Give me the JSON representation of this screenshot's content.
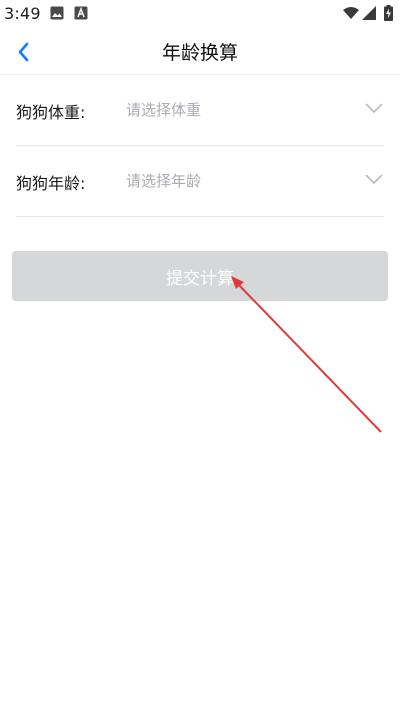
{
  "status_bar": {
    "time": "3:49",
    "icons": [
      "image-icon",
      "a-letter-icon",
      "wifi-icon",
      "signal-icon",
      "battery-charging-icon"
    ]
  },
  "nav": {
    "back_icon": "chevron-left-icon",
    "title": "年龄换算"
  },
  "form": {
    "weight": {
      "label": "狗狗体重:",
      "placeholder": "请选择体重",
      "icon": "chevron-down-icon"
    },
    "age": {
      "label": "狗狗年龄:",
      "placeholder": "请选择年龄",
      "icon": "chevron-down-icon"
    }
  },
  "submit": {
    "label": "提交计算"
  },
  "colors": {
    "accent": "#1677ff",
    "button_disabled": "#d6d7d9",
    "placeholder": "#a9acb3",
    "annotation": "#e03a3a"
  }
}
